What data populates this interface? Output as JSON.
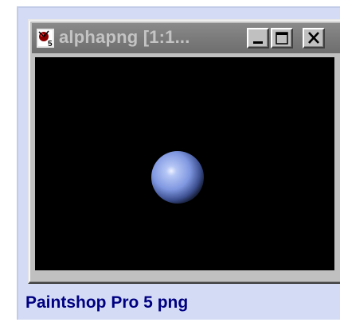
{
  "window": {
    "title": "alphapng [1:1...",
    "app_icon": "paintshop-pro-5-icon",
    "buttons": {
      "minimize_icon": "minimize-icon",
      "maximize_icon": "maximize-icon",
      "close_icon": "close-icon"
    }
  },
  "canvas": {
    "background": "#000000",
    "object": "blue-sphere",
    "sphere_color": "#7f97e0"
  },
  "caption": "Paintshop Pro 5 png",
  "colors": {
    "panel_bg": "#d4dcf5",
    "caption_color": "#000080",
    "titlebar_inactive": "#7b7b7b"
  }
}
